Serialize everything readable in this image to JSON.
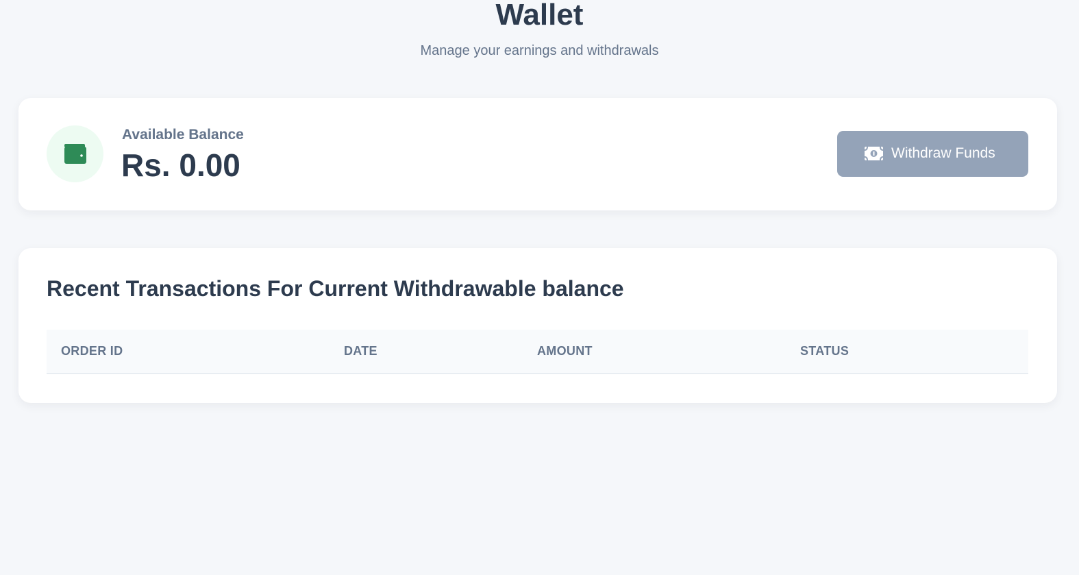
{
  "header": {
    "title": "Wallet",
    "subtitle": "Manage your earnings and withdrawals"
  },
  "balance": {
    "icon": "wallet-icon",
    "label": "Available Balance",
    "amount": "Rs. 0.00",
    "withdraw_button": {
      "icon": "money-bill-icon",
      "label": "Withdraw Funds"
    }
  },
  "transactions": {
    "title": "Recent Transactions For Current Withdrawable balance",
    "columns": [
      "ORDER ID",
      "DATE",
      "AMOUNT",
      "STATUS"
    ],
    "rows": []
  },
  "colors": {
    "background": "#f5f7fa",
    "card": "#ffffff",
    "text_primary": "#2d3b4e",
    "text_muted": "#64748b",
    "wallet_icon": "#2e8b57",
    "wallet_icon_bg": "#edfbf2",
    "button_disabled": "#94a3b8",
    "table_header_bg": "#f8fafc"
  }
}
